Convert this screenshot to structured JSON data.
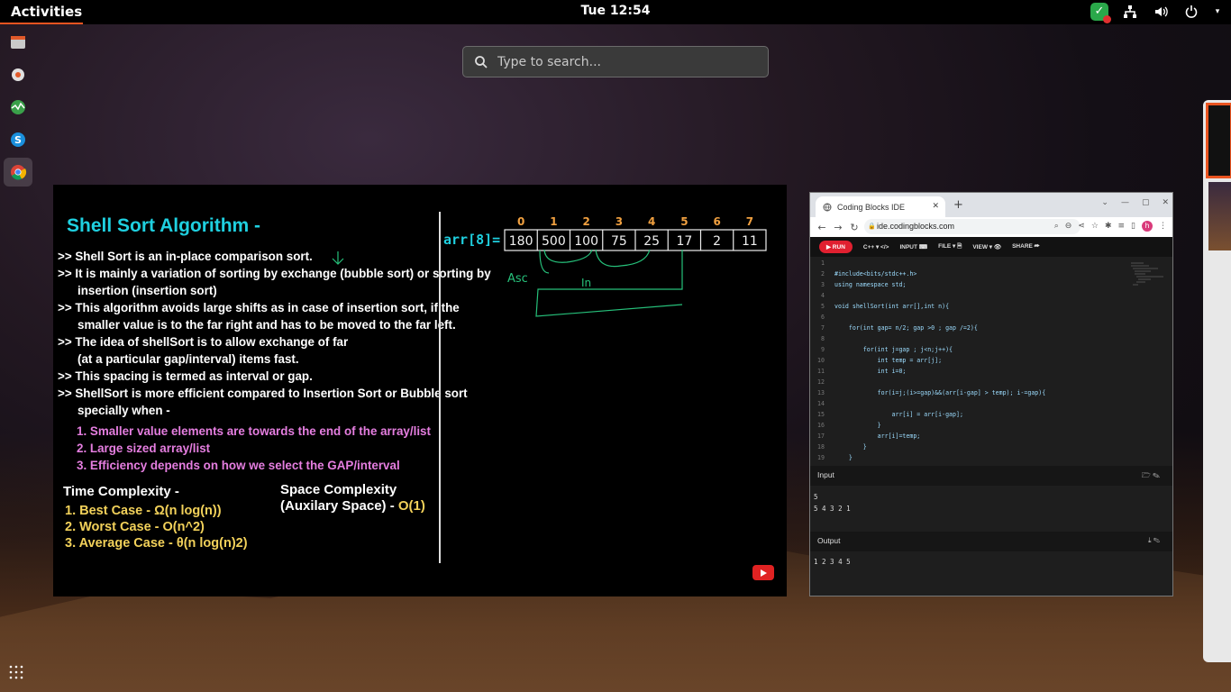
{
  "topbar": {
    "activities_label": "Activities",
    "clock": "Tue 12:54"
  },
  "dock": {
    "items": [
      "files",
      "settings",
      "system-monitor",
      "skype",
      "chrome"
    ],
    "active": "chrome"
  },
  "search": {
    "placeholder": "Type to search..."
  },
  "video": {
    "title": "Shell Sort Algorithm -",
    "lines": [
      ">> Shell Sort is an in-place comparison sort.",
      ">> It is mainly a variation of sorting by exchange (bubble sort) or sorting by",
      "insertion (insertion sort)",
      ">> This algorithm avoids large shifts as in case of insertion sort, if the",
      "smaller value is to the far right and has to be moved to the far left.",
      ">> The idea of shellSort is to allow exchange of far",
      "(at a particular gap/interval) items fast.",
      ">> This spacing is termed as interval or gap.",
      ">> ShellSort is more efficient compared to Insertion Sort or Bubble sort",
      "specially when -"
    ],
    "conditions": [
      "1. Smaller value elements are towards the end of the array/list",
      "2. Large sized array/list",
      "3. Efficiency depends on how we select the GAP/interval"
    ],
    "time_complexity_heading": "Time Complexity -",
    "time_complexity": [
      "1. Best Case - Ω(n log(n))",
      "2. Worst Case - O(n^2)",
      "3. Average Case - θ(n log(n)2)"
    ],
    "space_complexity_heading_1": "Space Complexity",
    "space_complexity_heading_2": "(Auxilary Space) - ",
    "space_complexity_value": "O(1)",
    "array_label": "arr[8]=",
    "indices": [
      "0",
      "1",
      "2",
      "3",
      "4",
      "5",
      "6",
      "7"
    ],
    "values": [
      "180",
      "500",
      "100",
      "75",
      "25",
      "17",
      "2",
      "11"
    ],
    "note_asc": "Asc",
    "note_in": "In"
  },
  "browser": {
    "tab_title": "Coding Blocks IDE",
    "url": "ide.codingblocks.com",
    "avatar_letter": "h",
    "toolbar": {
      "run": "▶ RUN",
      "lang": "C++ ▾ </>",
      "input": "INPUT ⌨",
      "file": "FILE ▾ 🗎",
      "view": "VIEW ▾ 👁",
      "share": "SHARE ⮫"
    },
    "code": [
      "",
      "#include<bits/stdc++.h>",
      "using namespace std;",
      "",
      "void shellSort(int arr[],int n){",
      "",
      "    for(int gap= n/2; gap >0 ; gap /=2){",
      "",
      "        for(int j=gap ; j<n;j++){",
      "            int temp = arr[j];",
      "            int i=0;",
      "",
      "            for(i=j;(i>=gap)&&(arr[i-gap] > temp); i-=gap){",
      "",
      "                arr[i] = arr[i-gap];",
      "            }",
      "            arr[i]=temp;",
      "        }",
      "    }"
    ],
    "input_label": "Input",
    "input_value": "5\n5 4 3 2 1",
    "output_label": "Output",
    "output_value": "1 2 3 4 5"
  }
}
